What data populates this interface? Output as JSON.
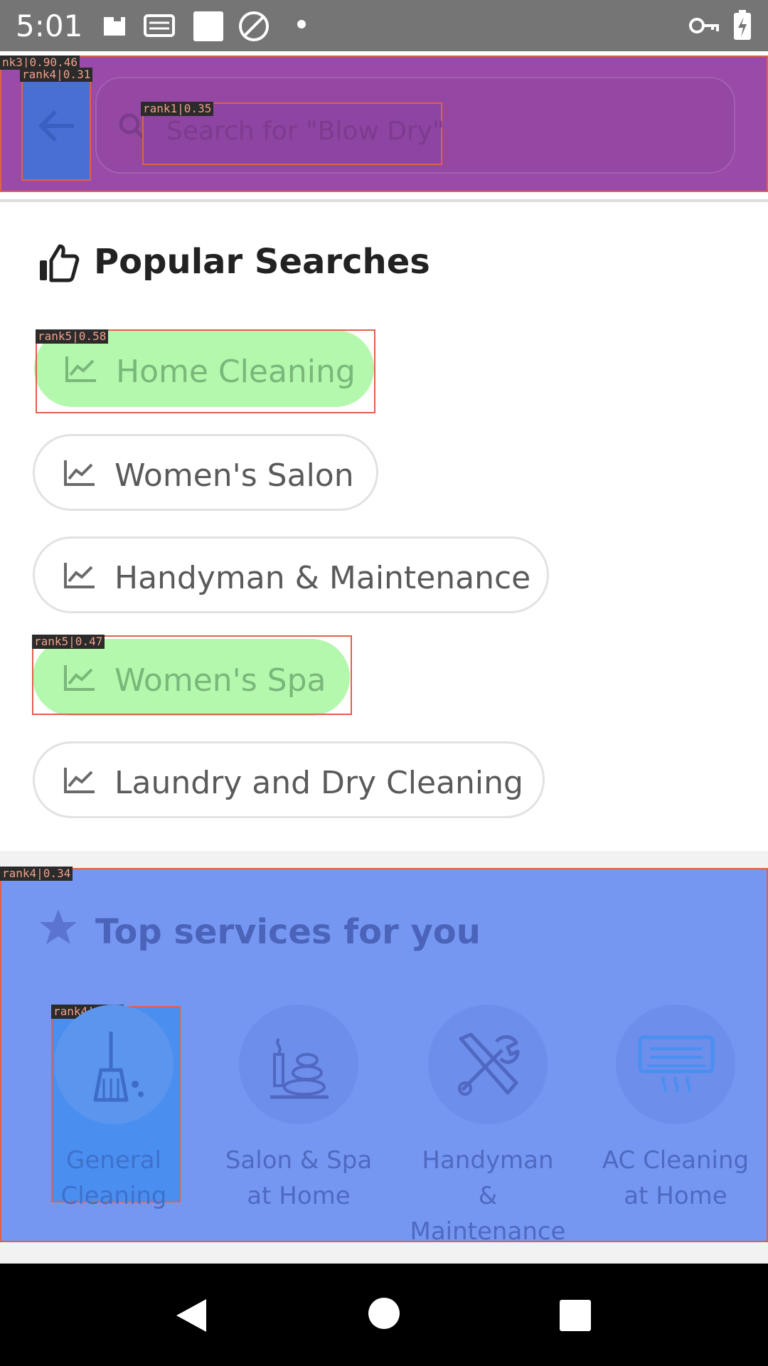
{
  "status_bar": {
    "time": "5:01",
    "icons": [
      "usb-icon",
      "sd-card-icon",
      "square-icon",
      "no-data-icon",
      "dot-icon",
      "vpn-key-icon",
      "battery-charging-icon"
    ]
  },
  "header": {
    "back_icon": "arrow-left-icon",
    "search_icon": "magnifier-icon",
    "search_placeholder": "Search for \"Blow Dry\""
  },
  "popular": {
    "title": "Popular Searches",
    "icon": "thumbs-up-icon",
    "chip_icon": "trending-icon",
    "items": [
      {
        "label": "Home Cleaning"
      },
      {
        "label": "Women's Salon"
      },
      {
        "label": "Handyman & Maintenance"
      },
      {
        "label": "Women's Spa"
      },
      {
        "label": "Laundry and Dry Cleaning"
      }
    ]
  },
  "services": {
    "title": "Top services for you",
    "icon": "star-icon",
    "items": [
      {
        "label": "General Cleaning",
        "icon": "broom-icon"
      },
      {
        "label": "Salon & Spa at Home",
        "icon": "spa-stones-icon"
      },
      {
        "label": "Handyman & Maintenance",
        "icon": "tools-icon"
      },
      {
        "label": "AC Cleaning at Home",
        "icon": "air-conditioner-icon"
      }
    ]
  },
  "annotations": {
    "header": "nk3|0.90.46",
    "back": "rank4|0.31",
    "search": "rank1|0.35",
    "chip_home": "rank5|0.58",
    "chip_spa": "rank5|0.47",
    "services": "rank4|0.34",
    "general": "rank4|0.46"
  },
  "colors": {
    "header_overlay": "#9a4aa8",
    "back_overlay": "#4a6fd4",
    "chip_overlay": "#b3f8ad",
    "services_overlay": "#7597f2",
    "annotation_border": "#e0604a"
  }
}
